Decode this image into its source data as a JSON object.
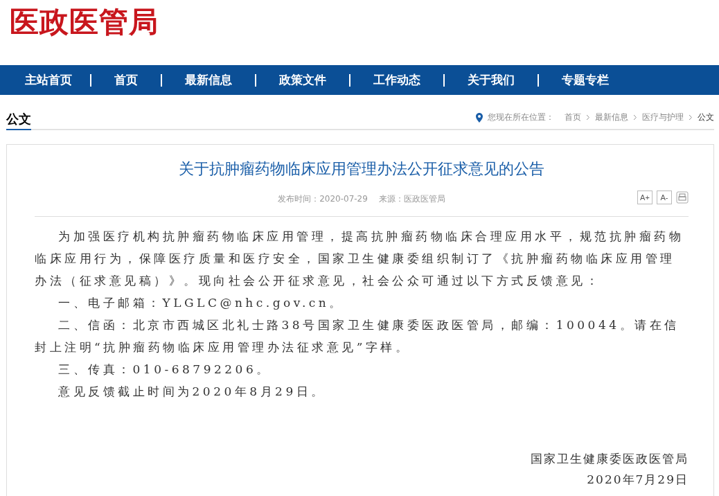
{
  "logo": "医政医管局",
  "nav": [
    "主站首页",
    "首页",
    "最新信息",
    "政策文件",
    "工作动态",
    "关于我们",
    "专题专栏"
  ],
  "section_title": "公文",
  "breadcrumb": {
    "prefix": "您现在所在位置：",
    "items": [
      "首页",
      "最新信息",
      "医疗与护理",
      "公文"
    ]
  },
  "article": {
    "title": "关于抗肿瘤药物临床应用管理办法公开征求意见的公告",
    "meta": [
      "发布时间：2020-07-29",
      "来源：医政医管局"
    ],
    "font_buttons": [
      "A+",
      "A-"
    ],
    "paragraphs": [
      {
        "kind": "indent",
        "text": "为加强医疗机构抗肿瘤药物临床应用管理，提高抗肿瘤药物临床合理应用水平，规范抗肿瘤药物临床应用行为，保障医疗质量和医疗安全，国家卫生健康委组织制订了《抗肿瘤药物临床应用管理办法（征求意见稿）》。现向社会公开征求意见，社会公众可通过以下方式反馈意见："
      },
      {
        "kind": "indent",
        "text": "一、电子邮箱：YLGLC@nhc.gov.cn。"
      },
      {
        "kind": "indent",
        "text": "二、信函：北京市西城区北礼士路38号国家卫生健康委医政医管局，邮编：100044。请在信封上注明“抗肿瘤药物临床应用管理办法征求意见”字样。"
      },
      {
        "kind": "indent",
        "text": "三、传真：010-68792206。"
      },
      {
        "kind": "indent",
        "text": "意见反馈截止时间为2020年8月29日。"
      },
      {
        "kind": "sign",
        "text": "国家卫生健康委医政医管局"
      },
      {
        "kind": "sign",
        "text": "2020年7月29日"
      }
    ]
  }
}
